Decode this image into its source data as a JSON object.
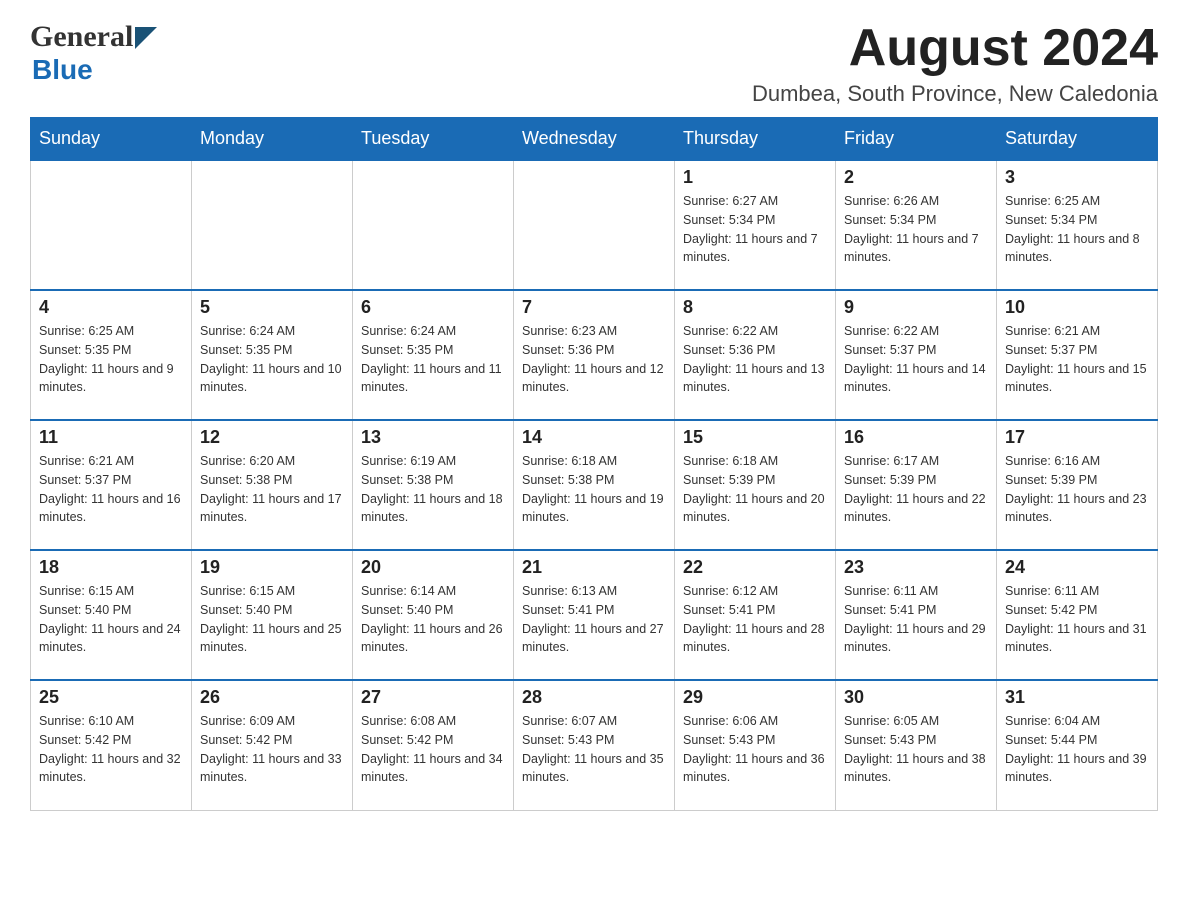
{
  "header": {
    "logo_general": "General",
    "logo_blue": "Blue",
    "month_title": "August 2024",
    "location": "Dumbea, South Province, New Caledonia"
  },
  "days_of_week": [
    "Sunday",
    "Monday",
    "Tuesday",
    "Wednesday",
    "Thursday",
    "Friday",
    "Saturday"
  ],
  "weeks": [
    [
      {
        "day": "",
        "sunrise": "",
        "sunset": "",
        "daylight": ""
      },
      {
        "day": "",
        "sunrise": "",
        "sunset": "",
        "daylight": ""
      },
      {
        "day": "",
        "sunrise": "",
        "sunset": "",
        "daylight": ""
      },
      {
        "day": "",
        "sunrise": "",
        "sunset": "",
        "daylight": ""
      },
      {
        "day": "1",
        "sunrise": "Sunrise: 6:27 AM",
        "sunset": "Sunset: 5:34 PM",
        "daylight": "Daylight: 11 hours and 7 minutes."
      },
      {
        "day": "2",
        "sunrise": "Sunrise: 6:26 AM",
        "sunset": "Sunset: 5:34 PM",
        "daylight": "Daylight: 11 hours and 7 minutes."
      },
      {
        "day": "3",
        "sunrise": "Sunrise: 6:25 AM",
        "sunset": "Sunset: 5:34 PM",
        "daylight": "Daylight: 11 hours and 8 minutes."
      }
    ],
    [
      {
        "day": "4",
        "sunrise": "Sunrise: 6:25 AM",
        "sunset": "Sunset: 5:35 PM",
        "daylight": "Daylight: 11 hours and 9 minutes."
      },
      {
        "day": "5",
        "sunrise": "Sunrise: 6:24 AM",
        "sunset": "Sunset: 5:35 PM",
        "daylight": "Daylight: 11 hours and 10 minutes."
      },
      {
        "day": "6",
        "sunrise": "Sunrise: 6:24 AM",
        "sunset": "Sunset: 5:35 PM",
        "daylight": "Daylight: 11 hours and 11 minutes."
      },
      {
        "day": "7",
        "sunrise": "Sunrise: 6:23 AM",
        "sunset": "Sunset: 5:36 PM",
        "daylight": "Daylight: 11 hours and 12 minutes."
      },
      {
        "day": "8",
        "sunrise": "Sunrise: 6:22 AM",
        "sunset": "Sunset: 5:36 PM",
        "daylight": "Daylight: 11 hours and 13 minutes."
      },
      {
        "day": "9",
        "sunrise": "Sunrise: 6:22 AM",
        "sunset": "Sunset: 5:37 PM",
        "daylight": "Daylight: 11 hours and 14 minutes."
      },
      {
        "day": "10",
        "sunrise": "Sunrise: 6:21 AM",
        "sunset": "Sunset: 5:37 PM",
        "daylight": "Daylight: 11 hours and 15 minutes."
      }
    ],
    [
      {
        "day": "11",
        "sunrise": "Sunrise: 6:21 AM",
        "sunset": "Sunset: 5:37 PM",
        "daylight": "Daylight: 11 hours and 16 minutes."
      },
      {
        "day": "12",
        "sunrise": "Sunrise: 6:20 AM",
        "sunset": "Sunset: 5:38 PM",
        "daylight": "Daylight: 11 hours and 17 minutes."
      },
      {
        "day": "13",
        "sunrise": "Sunrise: 6:19 AM",
        "sunset": "Sunset: 5:38 PM",
        "daylight": "Daylight: 11 hours and 18 minutes."
      },
      {
        "day": "14",
        "sunrise": "Sunrise: 6:18 AM",
        "sunset": "Sunset: 5:38 PM",
        "daylight": "Daylight: 11 hours and 19 minutes."
      },
      {
        "day": "15",
        "sunrise": "Sunrise: 6:18 AM",
        "sunset": "Sunset: 5:39 PM",
        "daylight": "Daylight: 11 hours and 20 minutes."
      },
      {
        "day": "16",
        "sunrise": "Sunrise: 6:17 AM",
        "sunset": "Sunset: 5:39 PM",
        "daylight": "Daylight: 11 hours and 22 minutes."
      },
      {
        "day": "17",
        "sunrise": "Sunrise: 6:16 AM",
        "sunset": "Sunset: 5:39 PM",
        "daylight": "Daylight: 11 hours and 23 minutes."
      }
    ],
    [
      {
        "day": "18",
        "sunrise": "Sunrise: 6:15 AM",
        "sunset": "Sunset: 5:40 PM",
        "daylight": "Daylight: 11 hours and 24 minutes."
      },
      {
        "day": "19",
        "sunrise": "Sunrise: 6:15 AM",
        "sunset": "Sunset: 5:40 PM",
        "daylight": "Daylight: 11 hours and 25 minutes."
      },
      {
        "day": "20",
        "sunrise": "Sunrise: 6:14 AM",
        "sunset": "Sunset: 5:40 PM",
        "daylight": "Daylight: 11 hours and 26 minutes."
      },
      {
        "day": "21",
        "sunrise": "Sunrise: 6:13 AM",
        "sunset": "Sunset: 5:41 PM",
        "daylight": "Daylight: 11 hours and 27 minutes."
      },
      {
        "day": "22",
        "sunrise": "Sunrise: 6:12 AM",
        "sunset": "Sunset: 5:41 PM",
        "daylight": "Daylight: 11 hours and 28 minutes."
      },
      {
        "day": "23",
        "sunrise": "Sunrise: 6:11 AM",
        "sunset": "Sunset: 5:41 PM",
        "daylight": "Daylight: 11 hours and 29 minutes."
      },
      {
        "day": "24",
        "sunrise": "Sunrise: 6:11 AM",
        "sunset": "Sunset: 5:42 PM",
        "daylight": "Daylight: 11 hours and 31 minutes."
      }
    ],
    [
      {
        "day": "25",
        "sunrise": "Sunrise: 6:10 AM",
        "sunset": "Sunset: 5:42 PM",
        "daylight": "Daylight: 11 hours and 32 minutes."
      },
      {
        "day": "26",
        "sunrise": "Sunrise: 6:09 AM",
        "sunset": "Sunset: 5:42 PM",
        "daylight": "Daylight: 11 hours and 33 minutes."
      },
      {
        "day": "27",
        "sunrise": "Sunrise: 6:08 AM",
        "sunset": "Sunset: 5:42 PM",
        "daylight": "Daylight: 11 hours and 34 minutes."
      },
      {
        "day": "28",
        "sunrise": "Sunrise: 6:07 AM",
        "sunset": "Sunset: 5:43 PM",
        "daylight": "Daylight: 11 hours and 35 minutes."
      },
      {
        "day": "29",
        "sunrise": "Sunrise: 6:06 AM",
        "sunset": "Sunset: 5:43 PM",
        "daylight": "Daylight: 11 hours and 36 minutes."
      },
      {
        "day": "30",
        "sunrise": "Sunrise: 6:05 AM",
        "sunset": "Sunset: 5:43 PM",
        "daylight": "Daylight: 11 hours and 38 minutes."
      },
      {
        "day": "31",
        "sunrise": "Sunrise: 6:04 AM",
        "sunset": "Sunset: 5:44 PM",
        "daylight": "Daylight: 11 hours and 39 minutes."
      }
    ]
  ]
}
